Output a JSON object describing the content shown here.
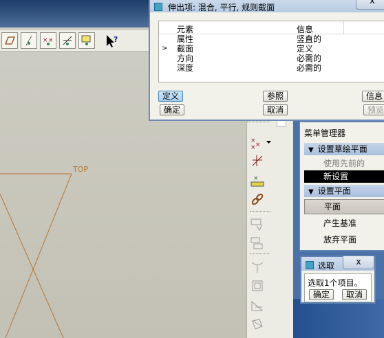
{
  "main_dialog": {
    "title": "伸出项: 混合, 平行, 规则截面",
    "close_label": "x",
    "columns": {
      "element": "元素",
      "info": "信息"
    },
    "rows": [
      {
        "element": "属性",
        "info": "竖直的",
        "current": false
      },
      {
        "element": "截面",
        "info": "定义",
        "current": true
      },
      {
        "element": "方向",
        "info": "必需的",
        "current": false
      },
      {
        "element": "深度",
        "info": "必需的",
        "current": false
      }
    ],
    "buttons": {
      "define": "定义",
      "refer": "参照",
      "info": "信息",
      "ok": "确定",
      "cancel": "取消",
      "preview": "预览"
    }
  },
  "menu_manager": {
    "title": "菜单管理器",
    "sections": [
      {
        "header": "设置草绘平面",
        "items": [
          "使用先前的",
          "新设置"
        ]
      },
      {
        "header": "设置平面",
        "items": [
          "平面",
          "产生基准",
          "放弃平面"
        ]
      }
    ]
  },
  "select_dialog": {
    "title": "选取",
    "close_label": "x",
    "message": "选取1个项目。",
    "ok": "确定",
    "cancel": "取消"
  },
  "canvas": {
    "datum_label": "TOP"
  },
  "colors": {
    "datum_orange": "#b9742e",
    "panel_blue": "#4a72a8",
    "title_blue": "#b7cbe3"
  }
}
